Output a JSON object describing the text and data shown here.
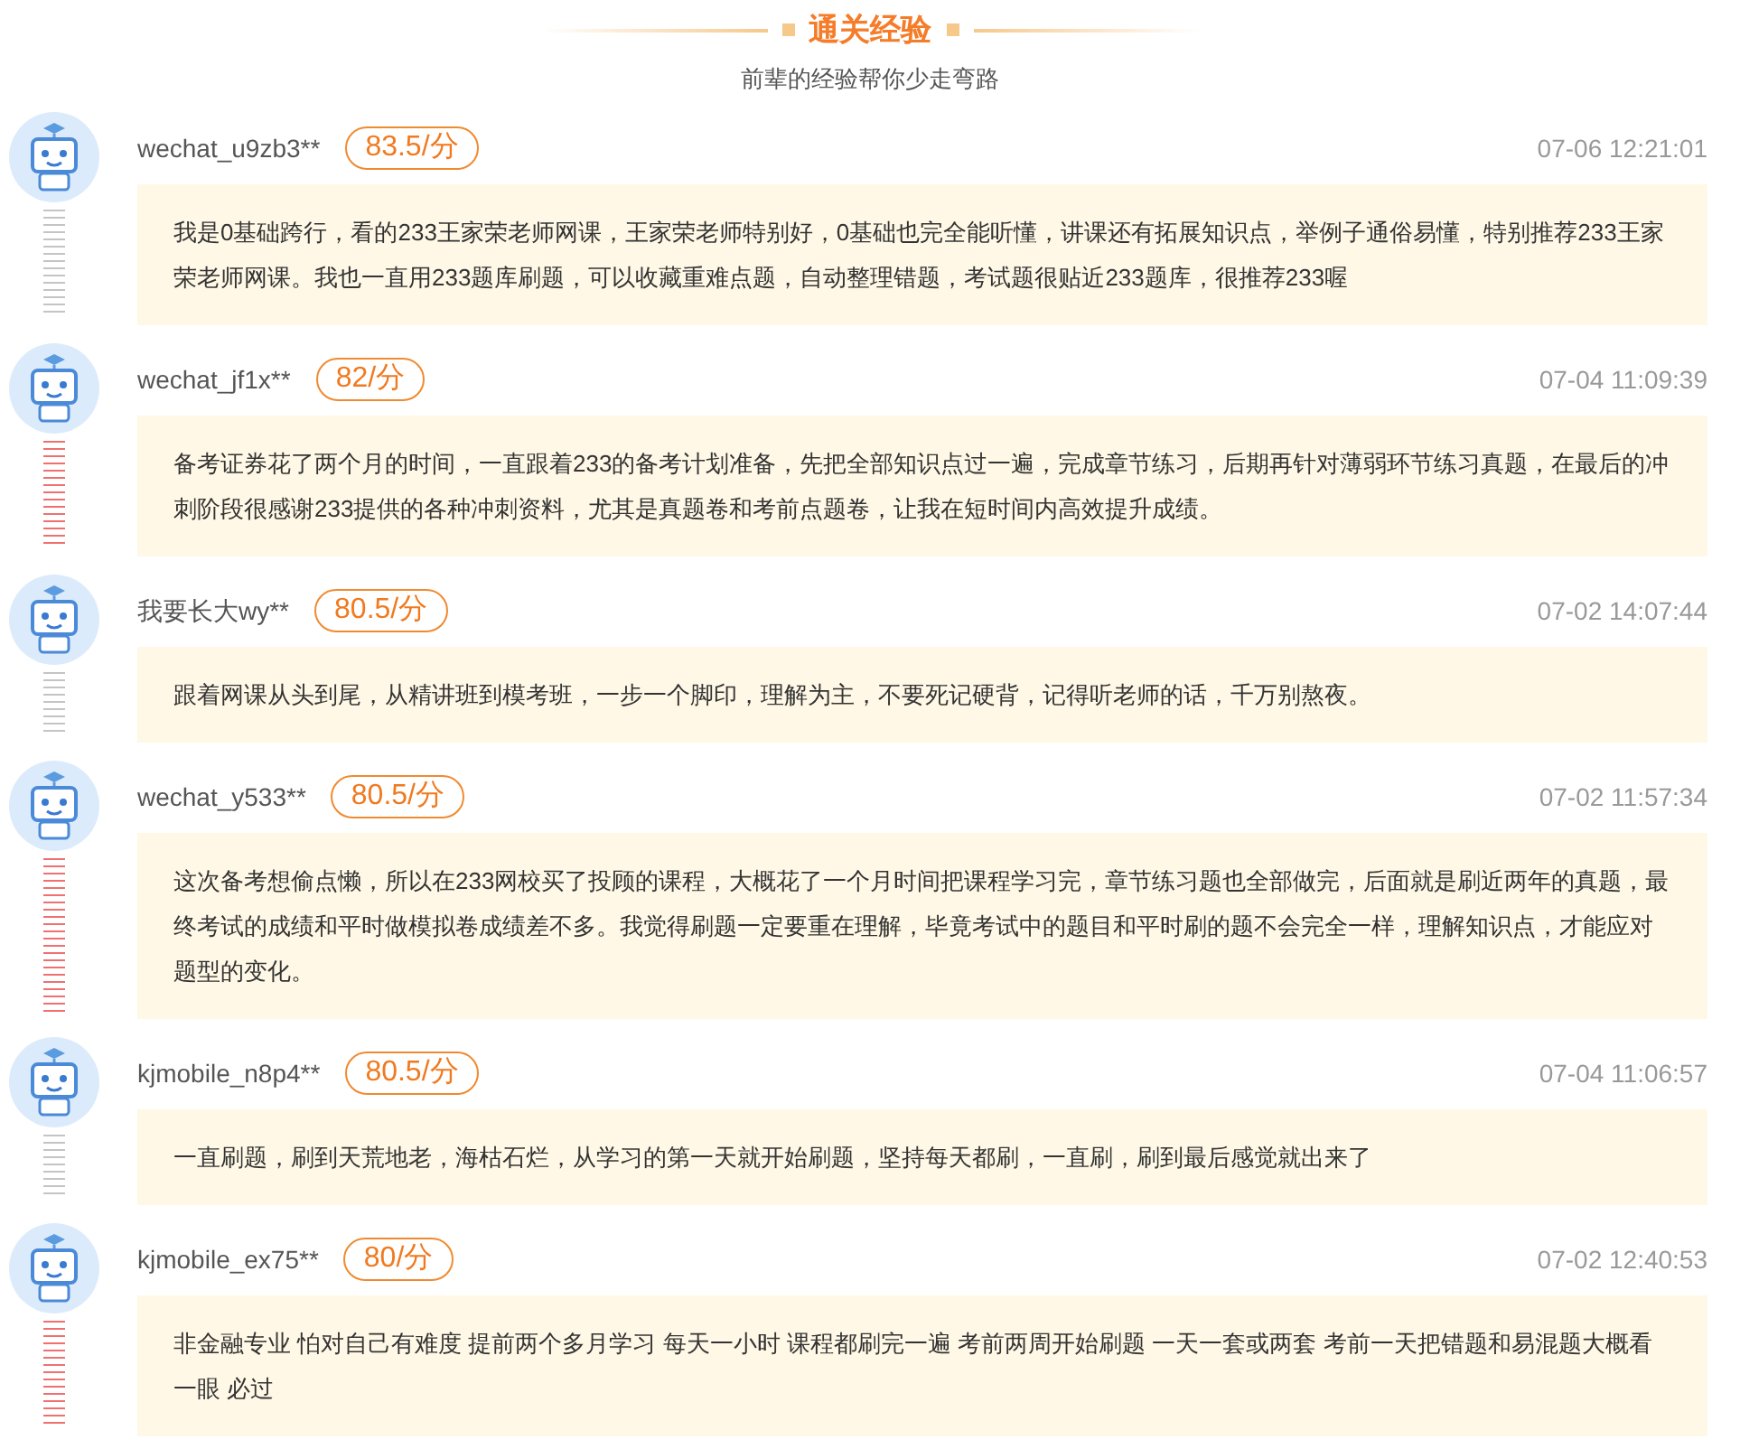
{
  "header": {
    "title": "通关经验",
    "subtitle": "前辈的经验帮你少走弯路"
  },
  "reviews": [
    {
      "user": "wechat_u9zb3**",
      "score": "83.5/分",
      "time": "07-06 12:21:01",
      "text": "我是0基础跨行，看的233王家荣老师网课，王家荣老师特别好，0基础也完全能听懂，讲课还有拓展知识点，举例子通俗易懂，特别推荐233王家荣老师网课。我也一直用233题库刷题，可以收藏重难点题，自动整理错题，考试题很贴近233题库，很推荐233喔",
      "color": "#c4c4c4"
    },
    {
      "user": "wechat_jf1x**",
      "score": "82/分",
      "time": "07-04 11:09:39",
      "text": "备考证券花了两个月的时间，一直跟着233的备考计划准备，先把全部知识点过一遍，完成章节练习，后期再针对薄弱环节练习真题，在最后的冲刺阶段很感谢233提供的各种冲刺资料，尤其是真题卷和考前点题卷，让我在短时间内高效提升成绩。",
      "color": "#f07070"
    },
    {
      "user": "我要长大wy**",
      "score": "80.5/分",
      "time": "07-02 14:07:44",
      "text": "跟着网课从头到尾，从精讲班到模考班，一步一个脚印，理解为主，不要死记硬背，记得听老师的话，千万别熬夜。",
      "color": "#c4c4c4"
    },
    {
      "user": "wechat_y533**",
      "score": "80.5/分",
      "time": "07-02 11:57:34",
      "text": "这次备考想偷点懒，所以在233网校买了投顾的课程，大概花了一个月时间把课程学习完，章节练习题也全部做完，后面就是刷近两年的真题，最终考试的成绩和平时做模拟卷成绩差不多。我觉得刷题一定要重在理解，毕竟考试中的题目和平时刷的题不会完全一样，理解知识点，才能应对题型的变化。",
      "color": "#f07070"
    },
    {
      "user": "kjmobile_n8p4**",
      "score": "80.5/分",
      "time": "07-04 11:06:57",
      "text": "一直刷题，刷到天荒地老，海枯石烂，从学习的第一天就开始刷题，坚持每天都刷，一直刷，刷到最后感觉就出来了",
      "color": "#c4c4c4"
    },
    {
      "user": "kjmobile_ex75**",
      "score": "80/分",
      "time": "07-02 12:40:53",
      "text": "非金融专业 怕对自己有难度 提前两个多月学习 每天一小时 课程都刷完一遍 考前两周开始刷题 一天一套或两套 考前一天把错题和易混题大概看一眼 必过",
      "color": "#f07070"
    }
  ]
}
